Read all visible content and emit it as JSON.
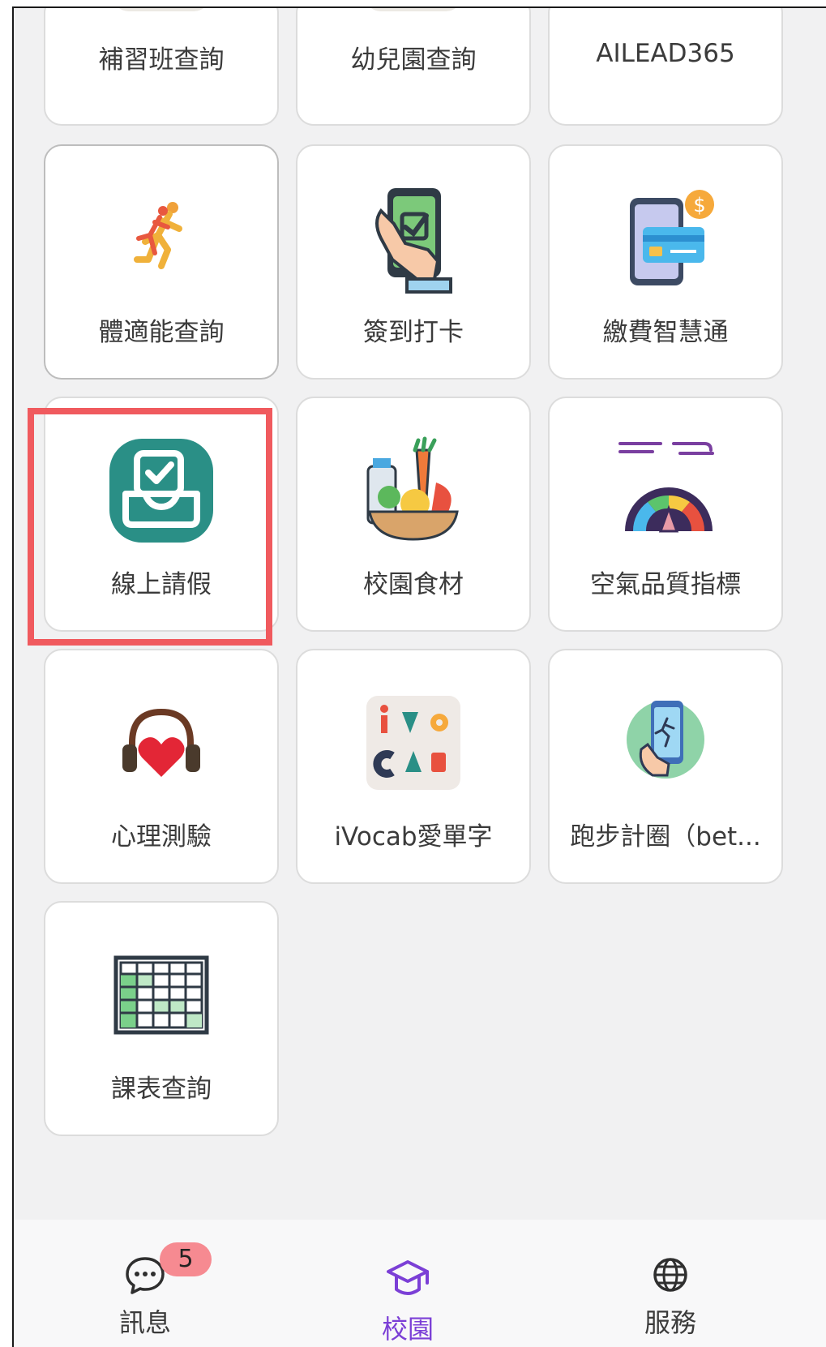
{
  "tiles": [
    {
      "label": "補習班查詢",
      "icon": "cram-school-icon"
    },
    {
      "label": "幼兒園查詢",
      "icon": "kindergarten-icon"
    },
    {
      "label": "AILEAD365",
      "icon": "ailead-icon"
    },
    {
      "label": "體適能查詢",
      "icon": "runner-icon"
    },
    {
      "label": "簽到打卡",
      "icon": "phone-checkin-icon"
    },
    {
      "label": "繳費智慧通",
      "icon": "payment-icon"
    },
    {
      "label": "線上請假",
      "icon": "leave-request-icon"
    },
    {
      "label": "校園食材",
      "icon": "food-basket-icon"
    },
    {
      "label": "空氣品質指標",
      "icon": "air-quality-gauge-icon"
    },
    {
      "label": "心理測驗",
      "icon": "heart-headphones-icon"
    },
    {
      "label": "iVocab愛單字",
      "icon": "ivocab-icon"
    },
    {
      "label": "跑步計圈（bet...",
      "icon": "running-app-icon"
    },
    {
      "label": "課表查詢",
      "icon": "timetable-icon"
    }
  ],
  "ivocab_logo": "iVoCAB",
  "tabbar": {
    "messages": {
      "label": "訊息",
      "badge": "5",
      "icon": "chat-icon"
    },
    "campus": {
      "label": "校園",
      "icon": "graduation-cap-icon"
    },
    "services": {
      "label": "服務",
      "icon": "globe-icon"
    }
  },
  "colors": {
    "accent": "#7b3fd6",
    "highlight": "#f05a5e",
    "badge": "#f68a91",
    "leave_icon": "#2a8f86"
  }
}
